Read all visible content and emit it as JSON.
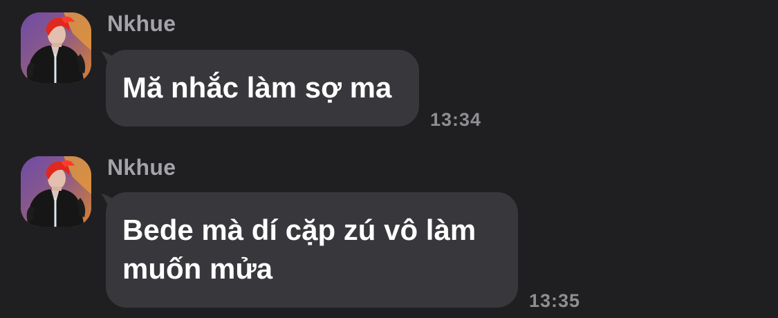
{
  "colors": {
    "background": "#1f1f21",
    "bubble": "#38383c",
    "sender_name": "#a3a3a8",
    "timestamp": "#8e8e93",
    "message_text": "#ffffff"
  },
  "messages": [
    {
      "sender": "Nkhue",
      "avatar_icon": "user-avatar-red-hair",
      "text": "Mă nhắc làm sợ ma",
      "time": "13:34"
    },
    {
      "sender": "Nkhue",
      "avatar_icon": "user-avatar-red-hair",
      "text": "Bede mà dí cặp zú vô làm\nmuốn mửa",
      "time": "13:35"
    }
  ]
}
